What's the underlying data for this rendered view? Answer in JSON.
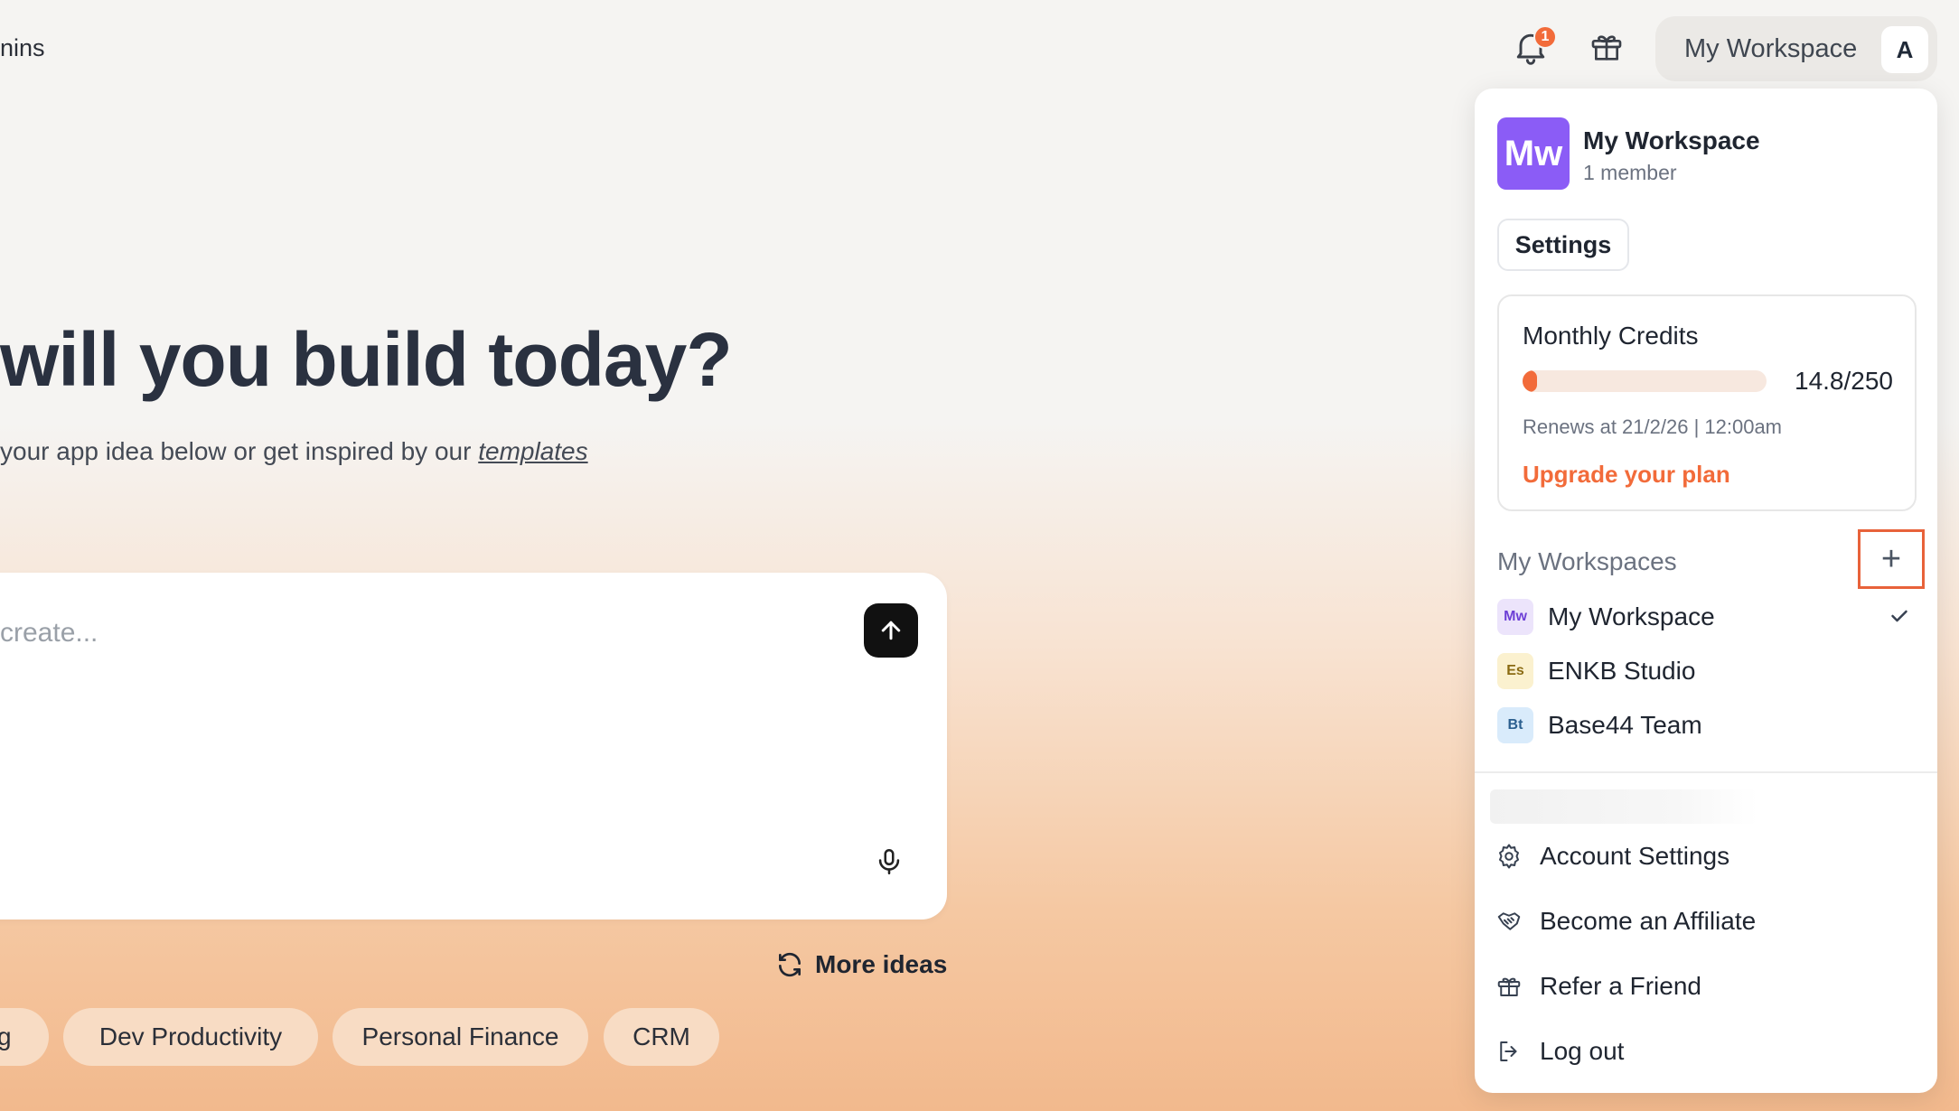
{
  "topbar": {
    "left_text": "nins",
    "notification_count": "1",
    "workspace_label": "My Workspace",
    "user_initial": "A"
  },
  "hero": {
    "title": "will you build today?",
    "subtitle_prefix": "your app idea below or get inspired by our ",
    "subtitle_link": "templates"
  },
  "prompt": {
    "placeholder": "create..."
  },
  "more_ideas_label": "More ideas",
  "chips": [
    "ng",
    "Dev Productivity",
    "Personal Finance",
    "CRM"
  ],
  "dropdown": {
    "avatar_initials": "Mw",
    "workspace_name": "My Workspace",
    "members": "1 member",
    "settings_label": "Settings",
    "credits": {
      "title": "Monthly Credits",
      "value": "14.8/250",
      "used": 14.8,
      "total": 250,
      "renews": "Renews at 21/2/26 | 12:00am",
      "upgrade_label": "Upgrade your plan"
    },
    "workspaces_title": "My Workspaces",
    "add_label": "+",
    "workspaces": [
      {
        "initials": "Mw",
        "name": "My Workspace",
        "selected": true,
        "bg": "#ece4fb",
        "fg": "#6d3fd6"
      },
      {
        "initials": "Es",
        "name": "ENKB Studio",
        "selected": false,
        "bg": "#fbf1cf",
        "fg": "#8a6a12"
      },
      {
        "initials": "Bt",
        "name": "Base44 Team",
        "selected": false,
        "bg": "#d9ebfb",
        "fg": "#2b5f8f"
      }
    ],
    "menu": [
      {
        "icon": "gear-icon",
        "label": "Account Settings"
      },
      {
        "icon": "handshake-icon",
        "label": "Become an Affiliate"
      },
      {
        "icon": "gift-icon",
        "label": "Refer a Friend"
      },
      {
        "icon": "logout-icon",
        "label": "Log out"
      }
    ]
  },
  "colors": {
    "accent": "#f26b3a",
    "highlight_border": "#e8623a",
    "avatar_purple": "#8b5cf6"
  }
}
